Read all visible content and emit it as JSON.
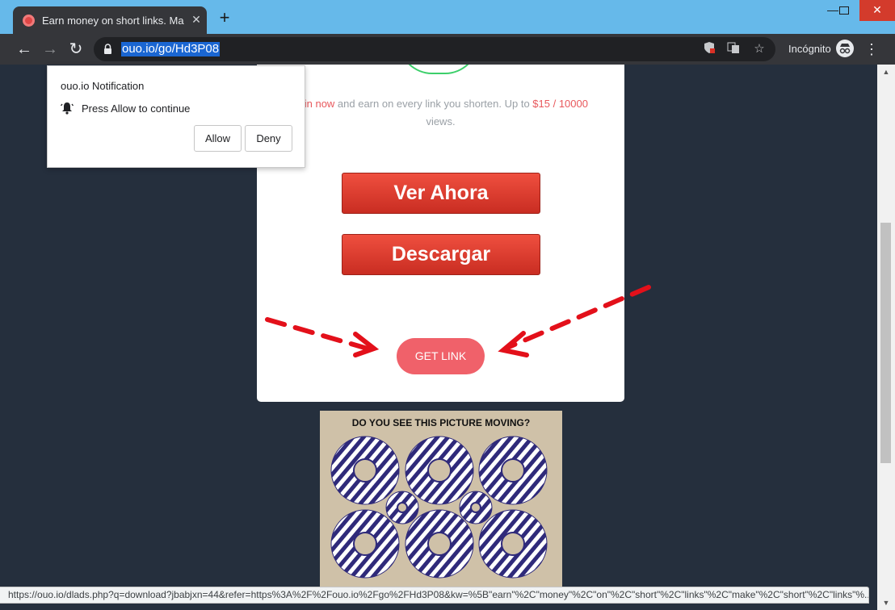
{
  "tab": {
    "title": "Earn money on short links. Make",
    "close": "✕"
  },
  "newtab": "+",
  "window": {
    "minimize": "—",
    "maximize": "☐",
    "close": "✕"
  },
  "toolbar": {
    "back": "←",
    "forward": "→",
    "reload": "↻",
    "url": "ouo.io/go/Hd3P08",
    "incognito_label": "Incógnito",
    "menu": "⋮"
  },
  "page": {
    "promo_link": "Join now",
    "promo_text_1": " and earn on every link you shorten. Up to ",
    "promo_amount": "$15 / 10000",
    "promo_text_2": " views.",
    "btn_ver": "Ver Ahora",
    "btn_descargar": "Descargar",
    "get_link": "GET LINK",
    "ad_title": "DO YOU SEE THIS PICTURE MOVING?"
  },
  "notification": {
    "title": "ouo.io Notification",
    "message": "Press Allow to continue",
    "allow": "Allow",
    "deny": "Deny"
  },
  "status_url": "https://ouo.io/dlads.php?q=download?jbabjxn=44&refer=https%3A%2F%2Fouo.io%2Fgo%2FHd3P08&kw=%5B\"earn\"%2C\"money\"%2C\"on\"%2C\"short\"%2C\"links\"%2C\"make\"%2C\"short\"%2C\"links\"%...",
  "colors": {
    "accent_red": "#e8585c",
    "button_red": "#e03a2f",
    "page_bg": "#252f3d",
    "url_highlight": "#1a66d2"
  },
  "icons": [
    "shield-blocked-icon",
    "translate-icon",
    "star-icon",
    "incognito-icon",
    "lock-icon",
    "bell-icon"
  ]
}
